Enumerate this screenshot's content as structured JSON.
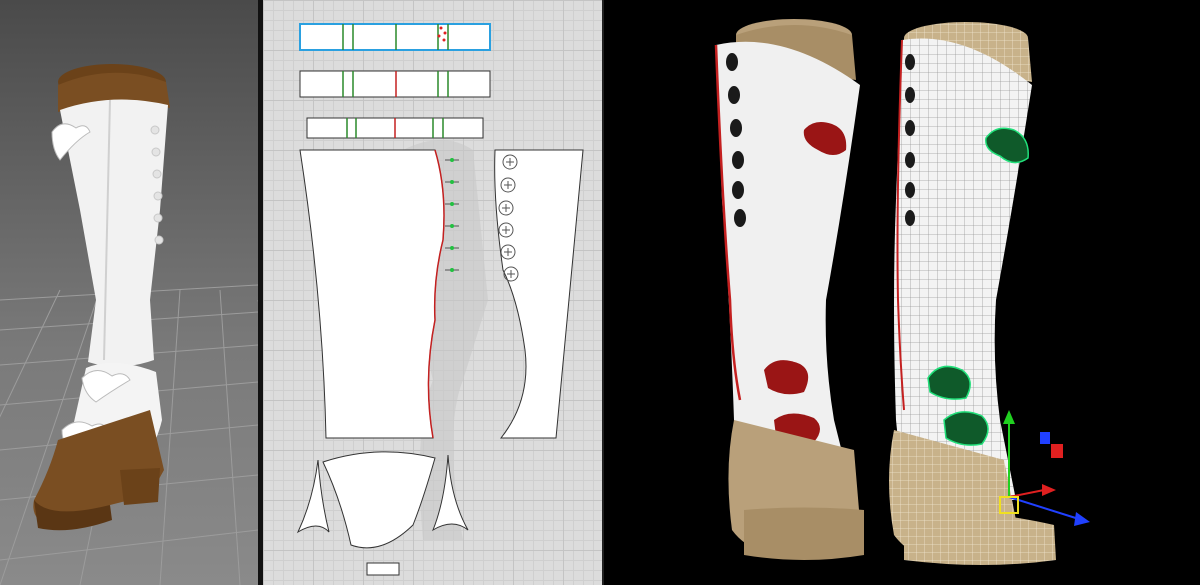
{
  "panels": {
    "viewport3d": {
      "icon": "boot-3d-preview"
    },
    "pattern2d": {
      "icon": "boot-sewing-pattern",
      "piece_count": 9,
      "button_markers": 6
    },
    "render": {
      "icon": "boot-render-and-wireframe",
      "gizmo": "move-gizmo"
    }
  },
  "colors": {
    "fabric_white": "#f2f2f2",
    "leather_brown": "#7a4e22",
    "sole_tan": "#b9a07a",
    "bow_red": "#9a1515",
    "selection_green": "#21e07a",
    "seam_red": "#c42020",
    "grid_bg": "#dcdcdc",
    "gizmo_x": "#e02020",
    "gizmo_y": "#20d020",
    "gizmo_z": "#2040ff"
  }
}
